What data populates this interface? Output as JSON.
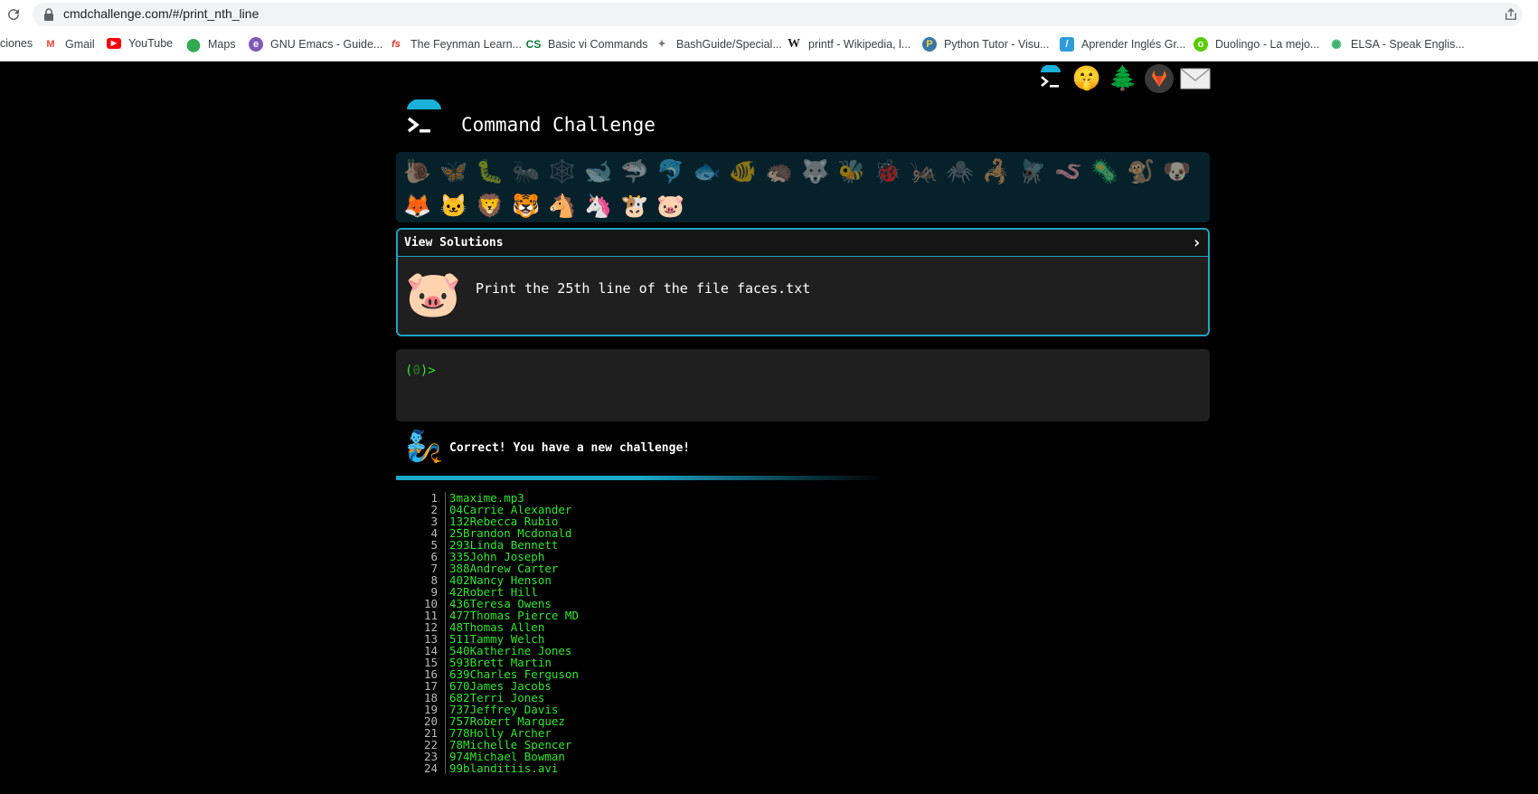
{
  "browser": {
    "url": "cmdchallenge.com/#/print_nth_line",
    "bookmarks": [
      {
        "label": "ciones",
        "icon": "apps-icon"
      },
      {
        "label": "Gmail",
        "icon": "gmail-icon"
      },
      {
        "label": "YouTube",
        "icon": "youtube-icon"
      },
      {
        "label": "Maps",
        "icon": "maps-icon"
      },
      {
        "label": "GNU Emacs - Guide...",
        "icon": "emacs-icon"
      },
      {
        "label": "The Feynman Learn...",
        "icon": "fs-icon"
      },
      {
        "label": "Basic vi Commands",
        "icon": "cs-icon"
      },
      {
        "label": "BashGuide/Special...",
        "icon": "bash-icon"
      },
      {
        "label": "printf - Wikipedia, l...",
        "icon": "wikipedia-icon"
      },
      {
        "label": "Python Tutor - Visu...",
        "icon": "python-icon"
      },
      {
        "label": "Aprender Inglés Gr...",
        "icon": "aprender-icon"
      },
      {
        "label": "Duolingo - La mejo...",
        "icon": "duolingo-icon"
      },
      {
        "label": "ELSA - Speak Englis...",
        "icon": "elsa-icon"
      }
    ]
  },
  "header": {
    "title": "Command Challenge",
    "top_icons": [
      "terminal-logo-icon",
      "face-icon",
      "tree-icon",
      "gitlab-icon",
      "mail-icon"
    ]
  },
  "challenge_emojis": [
    "🐌",
    "🦋",
    "🐛",
    "🐜",
    "🕸️",
    "🐋",
    "🦈",
    "🐬",
    "🐟",
    "🐠",
    "🦔",
    "🐺",
    "🐝",
    "🐞",
    "🦗",
    "🕷️",
    "🦂",
    "🪰",
    "🪱",
    "🦠",
    "🐒",
    "🐶",
    "🦊",
    "🐱",
    "🦁",
    "🐯",
    "🐴",
    "🦄",
    "🐮",
    "🐷"
  ],
  "solutions": {
    "header_label": "View Solutions",
    "chevron": "›",
    "face": "🐷",
    "challenge_text": "Print the 25th line of the file faces.txt"
  },
  "terminal": {
    "prompt_open": "(",
    "prompt_num": "0",
    "prompt_close": ")>"
  },
  "status": {
    "icon": "🧞",
    "message": "Correct! You have a new challenge!"
  },
  "output_lines": [
    {
      "n": "1",
      "t": "3maxime.mp3"
    },
    {
      "n": "2",
      "t": "04Carrie Alexander"
    },
    {
      "n": "3",
      "t": "132Rebecca Rubio"
    },
    {
      "n": "4",
      "t": "25Brandon Mcdonald"
    },
    {
      "n": "5",
      "t": "293Linda Bennett"
    },
    {
      "n": "6",
      "t": "335John Joseph"
    },
    {
      "n": "7",
      "t": "388Andrew Carter"
    },
    {
      "n": "8",
      "t": "402Nancy Henson"
    },
    {
      "n": "9",
      "t": "42Robert Hill"
    },
    {
      "n": "10",
      "t": "436Teresa Owens"
    },
    {
      "n": "11",
      "t": "477Thomas Pierce MD"
    },
    {
      "n": "12",
      "t": "48Thomas Allen"
    },
    {
      "n": "13",
      "t": "511Tammy Welch"
    },
    {
      "n": "14",
      "t": "540Katherine Jones"
    },
    {
      "n": "15",
      "t": "593Brett Martin"
    },
    {
      "n": "16",
      "t": "639Charles Ferguson"
    },
    {
      "n": "17",
      "t": "670James Jacobs"
    },
    {
      "n": "18",
      "t": "682Terri Jones"
    },
    {
      "n": "19",
      "t": "737Jeffrey Davis"
    },
    {
      "n": "20",
      "t": "757Robert Marquez"
    },
    {
      "n": "21",
      "t": "778Holly Archer"
    },
    {
      "n": "22",
      "t": "78Michelle Spencer"
    },
    {
      "n": "23",
      "t": "974Michael Bowman"
    },
    {
      "n": "24",
      "t": "99blanditiis.avi"
    }
  ],
  "colors": {
    "accent": "#20a4c4",
    "terminal_green": "#2ee82e",
    "panel_bg": "#1f1f1f",
    "emoji_bar_bg": "#07212b"
  }
}
